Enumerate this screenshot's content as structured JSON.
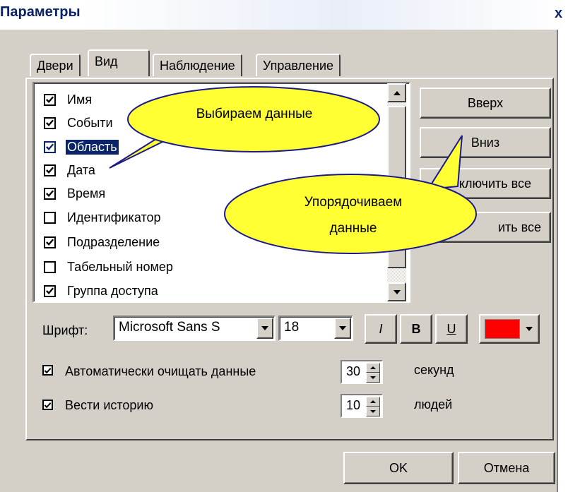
{
  "window": {
    "title": "Параметры",
    "close": "x"
  },
  "tabs": [
    {
      "label": "Двери",
      "active": false
    },
    {
      "label": "Вид",
      "active": true
    },
    {
      "label": "Наблюдение",
      "active": false
    },
    {
      "label": "Управление",
      "active": false
    }
  ],
  "list": {
    "items": [
      {
        "label": "Имя",
        "checked": true,
        "selected": false
      },
      {
        "label": "Событи",
        "checked": true,
        "selected": false
      },
      {
        "label": "Область",
        "checked": true,
        "selected": true
      },
      {
        "label": "Дата",
        "checked": true,
        "selected": false
      },
      {
        "label": "Время",
        "checked": true,
        "selected": false
      },
      {
        "label": "Идентификатор",
        "checked": false,
        "selected": false
      },
      {
        "label": "Подразделение",
        "checked": true,
        "selected": false
      },
      {
        "label": "Табельный номер",
        "checked": false,
        "selected": false
      },
      {
        "label": "Группа доступа",
        "checked": true,
        "selected": false
      }
    ]
  },
  "side_buttons": {
    "up": "Вверх",
    "down": "Вниз",
    "enable_all": "ключить все",
    "disable_all": "ить все"
  },
  "callouts": {
    "choose": "Выбираем данные",
    "order_line1": "Упорядочиваем",
    "order_line2": "данные"
  },
  "font_row": {
    "label": "Шрифт:",
    "font_name": "Microsoft  Sans S",
    "font_size": "18",
    "italic": "I",
    "bold": "B",
    "underline": "U",
    "color": "#ff0000"
  },
  "options": {
    "auto_clear_label": "Автоматически очищать данные",
    "auto_clear_value": "30",
    "auto_clear_unit": "секунд",
    "history_label": "Вести историю",
    "history_value": "10",
    "history_unit": "людей"
  },
  "footer": {
    "ok": "OK",
    "cancel": "Отмена"
  }
}
